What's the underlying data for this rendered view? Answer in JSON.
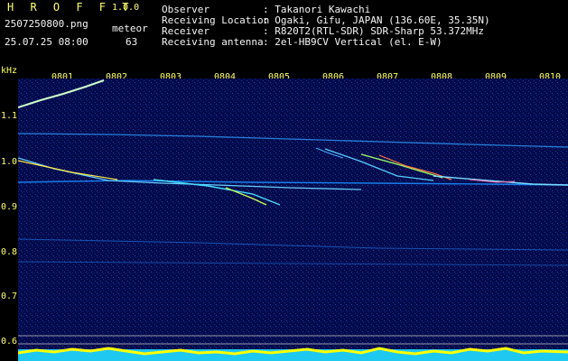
{
  "header": {
    "app_title": "H R O F F T",
    "app_version": "1.0.0",
    "file_name": "2507250800.png",
    "meteor_label": "meteor",
    "date_time": "25.07.25 08:00",
    "meteor_count": "63"
  },
  "metadata": {
    "observer_key": "Observer",
    "observer_val": ": Takanori Kawachi",
    "location_key": "Receiving Location",
    "location_val": ": Ogaki, Gifu, JAPAN (136.60E, 35.35N)",
    "receiver_key": "Receiver",
    "receiver_val": ": R820T2(RTL-SDR) SDR-Sharp 53.372MHz",
    "antenna_key": "Receiving antenna",
    "antenna_val": ": 2el-HB9CV Vertical (el. E-W)"
  },
  "axis": {
    "unit": "kHz",
    "y_labels": [
      "1.1",
      "1.0",
      "0.9",
      "0.8",
      "0.7",
      "0.6"
    ],
    "x_labels": [
      "0801",
      "0802",
      "0803",
      "0804",
      "0805",
      "0806",
      "0807",
      "0808",
      "0809",
      "0810"
    ]
  },
  "colors": {
    "header_text": "#ffff66",
    "background": "#030a4a",
    "strong_echo": "#ffee44",
    "echo": "#44ddff"
  }
}
